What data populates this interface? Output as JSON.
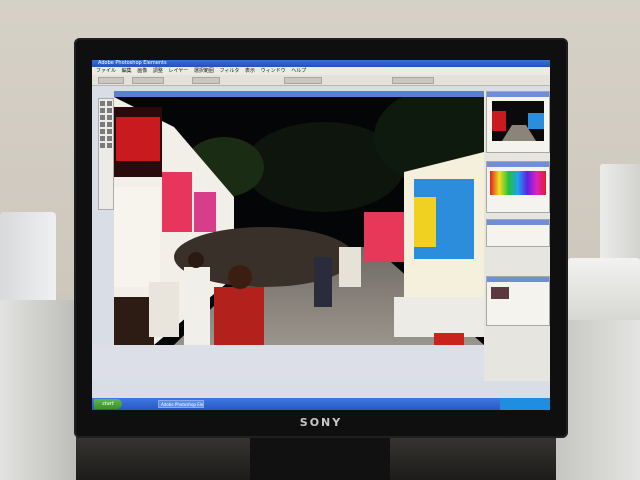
{
  "monitor": {
    "brand": "SONY"
  },
  "app": {
    "title": "Adobe Photoshop Elements",
    "menus": [
      "ファイル",
      "編集",
      "画像",
      "調整",
      "レイヤー",
      "選択範囲",
      "フィルタ",
      "表示",
      "ウィンドウ",
      "ヘルプ"
    ]
  },
  "taskbar": {
    "start_label": "start",
    "task_label": "Adobe Photoshop Ele..."
  },
  "colors": {
    "bezel": "#0f0f10",
    "titlebar": "#2451b8",
    "taskbar": "#2758c4",
    "start_button": "#3c8e2e"
  }
}
